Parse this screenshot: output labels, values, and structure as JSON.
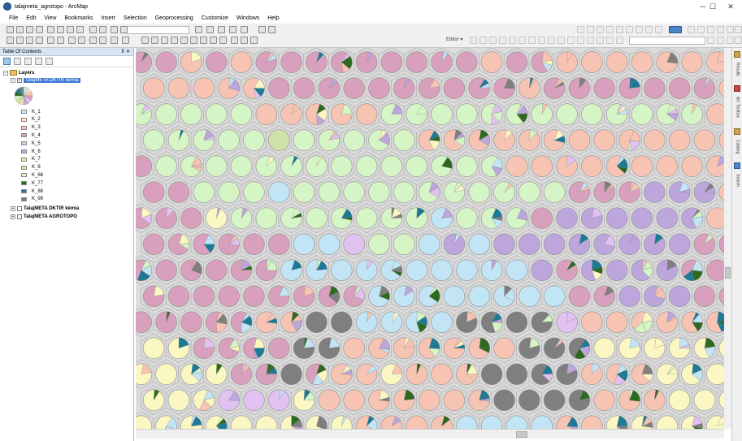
{
  "app": {
    "title": "talajmeta_agrotopo - ArcMap"
  },
  "window": {
    "minimize_glyph": "─",
    "maximize_glyph": "☐",
    "close_glyph": "✕"
  },
  "menu": [
    "File",
    "Edit",
    "View",
    "Bookmarks",
    "Insert",
    "Selection",
    "Geoprocessing",
    "Customize",
    "Windows",
    "Help"
  ],
  "toolbar": {
    "editor_label": "Editor ▾",
    "scale_value": "",
    "blue_swatch": "#2f6fb5"
  },
  "toc": {
    "title": "Table Of Contents",
    "pin_glyph": "⊼ ✕",
    "root": "Layers",
    "selected_layer": "TalajMETA DKTIR kémia",
    "legend": [
      {
        "label": "K_1",
        "color": "#c7e6f5"
      },
      {
        "label": "K_2",
        "color": "#fde7c8"
      },
      {
        "label": "K_3",
        "color": "#f7c3b0"
      },
      {
        "label": "K_4",
        "color": "#d8a0bd"
      },
      {
        "label": "K_5",
        "color": "#e5c4f0"
      },
      {
        "label": "K_6",
        "color": "#bfa6d9"
      },
      {
        "label": "K_7",
        "color": "#f3e6a9"
      },
      {
        "label": "K_8",
        "color": "#cfe3a8"
      },
      {
        "label": "K_66",
        "color": "#d8f5c6"
      },
      {
        "label": "K_77",
        "color": "#2d6a1f"
      },
      {
        "label": "K_88",
        "color": "#1c7a96"
      },
      {
        "label": "K_99",
        "color": "#7e7e7e"
      }
    ],
    "other_layers": [
      "TalajMETA DKTIR kémia",
      "TalajMETA AGROTOPO"
    ]
  },
  "dock": {
    "items": [
      "Results",
      "Arc Toolbox",
      "Catalog",
      "Search"
    ]
  },
  "map": {
    "cols": 24,
    "rows": 15,
    "hex_fill": "#d9d9d9",
    "hex_stroke": "#b5b5b5",
    "grid": [
      "DDCDCDDDDDDDDDCDDCCCCCCC",
      "CCCCCDDDDDDDDDDCDDDDDDDC",
      "IIIIICCCCCIIIIIIIIIIIIIC",
      "IIIIIHIIIIICCCCCCCCCCCCC",
      "DIIIIIIIIIIIIIICCCCCCCCC",
      "DDIIIAIIIIIIIIIIIDDDFFFC",
      "DDDGIIIIIIIIAIIIDFFFFFFC",
      "DDDDDDAAEIIAFAFFFFFFFFDD",
      "DDDDDDAAAAAAAAAAFDFFFFDD",
      "DDDDDDDDDAAAAAAAADDFFFDD",
      "DDDDDCCLLAAAALLLLECCCCCC",
      "GGDDDDLLCCCCCCCLLLGGGGGG",
      "GGGGDDLDCCGCCCLLLLCCCGGG",
      "GGGEEEGCCCCCCCLLLLCCCGGG",
      "GGGGGGGGGCCCCAAAACCGGGGG"
    ],
    "palette": {
      "A": "#c2e5f6",
      "C": "#f7c4b3",
      "D": "#d8a0bd",
      "E": "#e0c1ef",
      "F": "#bca6dc",
      "G": "#fbf7c2",
      "H": "#cfe3a8",
      "I": "#d6f5c6",
      "L": "#7f7f7f"
    },
    "accents": [
      "#1c7a96",
      "#2d6a1f",
      "#7f7f7f",
      "#e0c1ef",
      "#f7c4b3",
      "#fbf7c2",
      "#c2e5f6",
      "#d6f5c6",
      "#bca6dc"
    ]
  }
}
